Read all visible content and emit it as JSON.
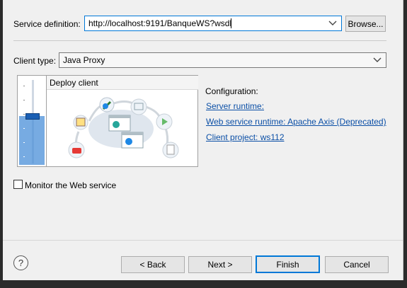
{
  "service_definition": {
    "label": "Service definition:",
    "value": "http://localhost:9191/BanqueWS?wsdl",
    "browse_label": "Browse..."
  },
  "client_type": {
    "label": "Client type:",
    "value": "Java Proxy"
  },
  "deploy": {
    "level_label": "Deploy client",
    "slider_level_fraction": 0.6
  },
  "configuration": {
    "heading": "Configuration:",
    "server_runtime": "Server runtime:",
    "web_service_runtime": "Web service runtime: Apache Axis (Deprecated)",
    "client_project": "Client project: ws112"
  },
  "monitor": {
    "label": "Monitor the Web service",
    "checked": false
  },
  "buttons": {
    "help_symbol": "?",
    "back": "< Back",
    "next": "Next >",
    "finish": "Finish",
    "cancel": "Cancel"
  },
  "colors": {
    "link": "#0b4fa6",
    "focus_border": "#0078d7",
    "slider_fill": "#4a8fd8"
  }
}
